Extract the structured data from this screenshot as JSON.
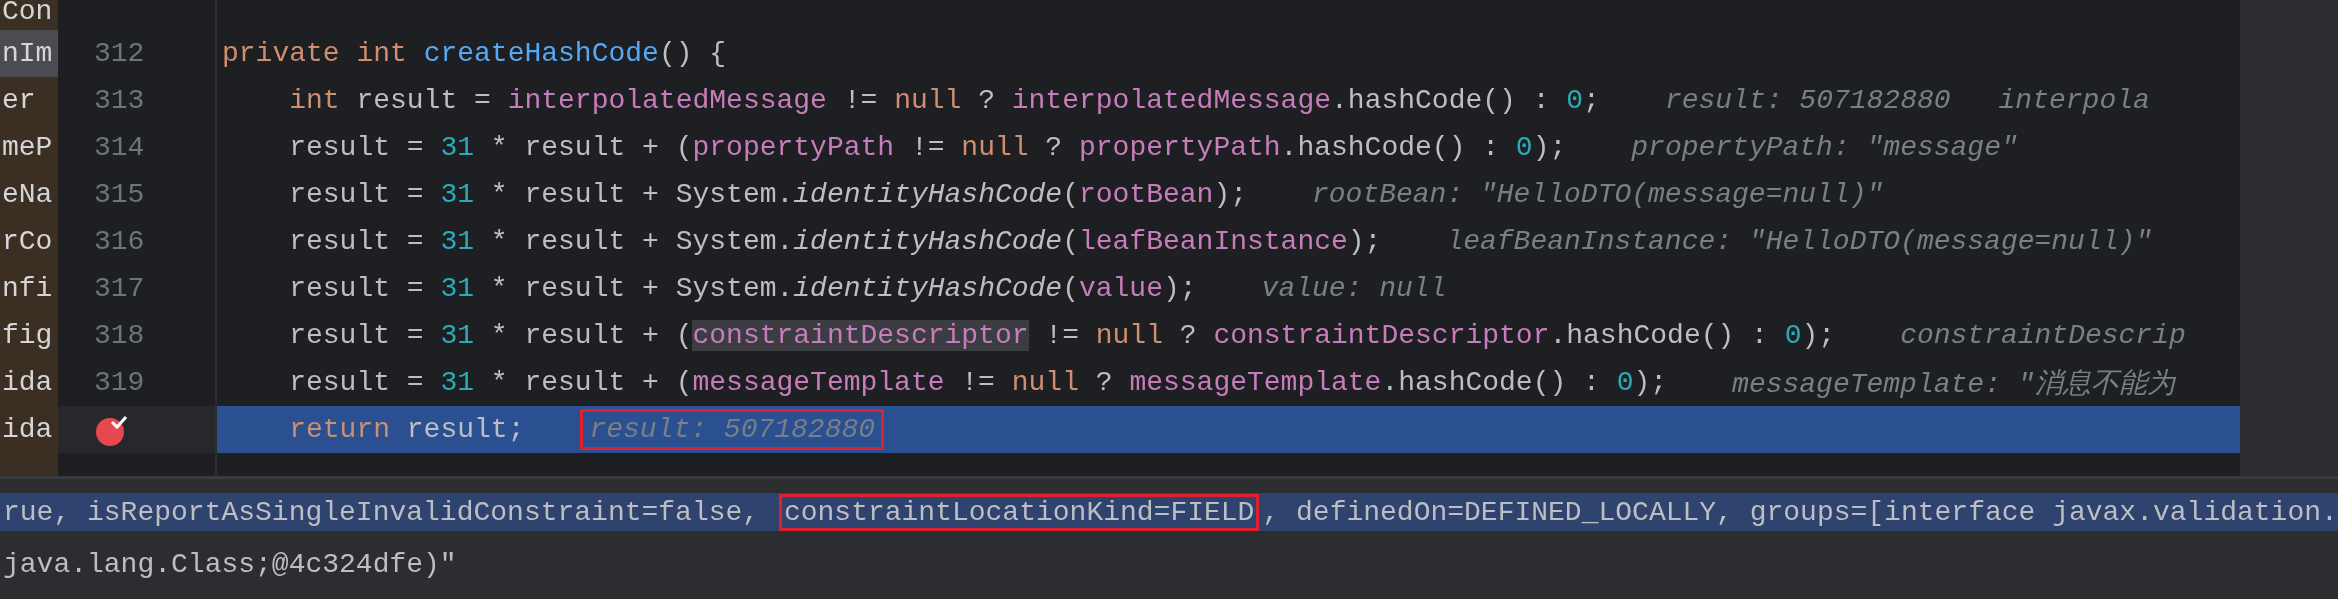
{
  "project_tree": {
    "items": [
      {
        "label": "Con",
        "selected": false
      },
      {
        "label": "nIm",
        "selected": true
      },
      {
        "label": "er",
        "selected": false
      },
      {
        "label": "meP",
        "selected": false
      },
      {
        "label": "eNa",
        "selected": false
      },
      {
        "label": "rCo",
        "selected": false
      },
      {
        "label": "nfi",
        "selected": false
      },
      {
        "label": "fig",
        "selected": false
      },
      {
        "label": "ida",
        "selected": false
      },
      {
        "label": "ida",
        "selected": false
      }
    ]
  },
  "editor": {
    "lines": [
      {
        "number": "312",
        "breakpoint": false,
        "current": false,
        "tokens": [
          {
            "kind": "keyword",
            "text": "private int "
          },
          {
            "kind": "function",
            "text": "createHashCode"
          },
          {
            "kind": "plain",
            "text": "() {"
          }
        ],
        "children": [
          {
            "number": "313",
            "breakpoint": false,
            "current": false,
            "tokens": [
              {
                "kind": "keyword",
                "text": "int "
              },
              {
                "kind": "plain",
                "text": "result = "
              },
              {
                "kind": "field",
                "text": "interpolatedMessage"
              },
              {
                "kind": "plain",
                "text": " != "
              },
              {
                "kind": "keyword",
                "text": "null"
              },
              {
                "kind": "plain",
                "text": " ? "
              },
              {
                "kind": "field",
                "text": "interpolatedMessage"
              },
              {
                "kind": "plain",
                "text": ".hashCode() : "
              },
              {
                "kind": "number",
                "text": "0"
              },
              {
                "kind": "plain",
                "text": ";"
              }
            ],
            "hints": [
              {
                "text": "result: 507182880",
                "outlined": false
              },
              {
                "text": "interpola",
                "outlined": false
              }
            ]
          },
          {
            "number": "314",
            "breakpoint": false,
            "current": false,
            "tokens": [
              {
                "kind": "plain",
                "text": "result = "
              },
              {
                "kind": "number",
                "text": "31"
              },
              {
                "kind": "plain",
                "text": " * result + ("
              },
              {
                "kind": "field",
                "text": "propertyPath"
              },
              {
                "kind": "plain",
                "text": " != "
              },
              {
                "kind": "keyword",
                "text": "null"
              },
              {
                "kind": "plain",
                "text": " ? "
              },
              {
                "kind": "field",
                "text": "propertyPath"
              },
              {
                "kind": "plain",
                "text": ".hashCode() : "
              },
              {
                "kind": "number",
                "text": "0"
              },
              {
                "kind": "plain",
                "text": ");"
              }
            ],
            "hints": [
              {
                "text": "propertyPath: \"message\"",
                "outlined": false
              }
            ]
          },
          {
            "number": "315",
            "breakpoint": false,
            "current": false,
            "tokens": [
              {
                "kind": "plain",
                "text": "result = "
              },
              {
                "kind": "number",
                "text": "31"
              },
              {
                "kind": "plain",
                "text": " * result + System."
              },
              {
                "kind": "call",
                "text": "identityHashCode"
              },
              {
                "kind": "plain",
                "text": "("
              },
              {
                "kind": "field",
                "text": "rootBean"
              },
              {
                "kind": "plain",
                "text": ");"
              }
            ],
            "hints": [
              {
                "text": "rootBean: \"HelloDTO(message=null)\"",
                "outlined": false
              }
            ]
          },
          {
            "number": "316",
            "breakpoint": false,
            "current": false,
            "tokens": [
              {
                "kind": "plain",
                "text": "result = "
              },
              {
                "kind": "number",
                "text": "31"
              },
              {
                "kind": "plain",
                "text": " * result + System."
              },
              {
                "kind": "call",
                "text": "identityHashCode"
              },
              {
                "kind": "plain",
                "text": "("
              },
              {
                "kind": "field",
                "text": "leafBeanInstance"
              },
              {
                "kind": "plain",
                "text": ");"
              }
            ],
            "hints": [
              {
                "text": "leafBeanInstance: \"HelloDTO(message=null)\"",
                "outlined": false
              }
            ]
          },
          {
            "number": "317",
            "breakpoint": false,
            "current": false,
            "tokens": [
              {
                "kind": "plain",
                "text": "result = "
              },
              {
                "kind": "number",
                "text": "31"
              },
              {
                "kind": "plain",
                "text": " * result + System."
              },
              {
                "kind": "call",
                "text": "identityHashCode"
              },
              {
                "kind": "plain",
                "text": "("
              },
              {
                "kind": "field",
                "text": "value"
              },
              {
                "kind": "plain",
                "text": ");"
              }
            ],
            "hints": [
              {
                "text": "value: null",
                "outlined": false
              }
            ]
          },
          {
            "number": "318",
            "breakpoint": false,
            "current": false,
            "tokens": [
              {
                "kind": "plain",
                "text": "result = "
              },
              {
                "kind": "number",
                "text": "31"
              },
              {
                "kind": "plain",
                "text": " * result + ("
              },
              {
                "kind": "field",
                "text": "constraintDescriptor",
                "highlighted": true
              },
              {
                "kind": "plain",
                "text": " != "
              },
              {
                "kind": "keyword",
                "text": "null"
              },
              {
                "kind": "plain",
                "text": " ? "
              },
              {
                "kind": "field",
                "text": "constraintDescriptor"
              },
              {
                "kind": "plain",
                "text": ".hashCode() : "
              },
              {
                "kind": "number",
                "text": "0"
              },
              {
                "kind": "plain",
                "text": ");"
              }
            ],
            "hints": [
              {
                "text": "constraintDescrip",
                "outlined": false
              }
            ]
          },
          {
            "number": "319",
            "breakpoint": false,
            "current": false,
            "tokens": [
              {
                "kind": "plain",
                "text": "result = "
              },
              {
                "kind": "number",
                "text": "31"
              },
              {
                "kind": "plain",
                "text": " * result + ("
              },
              {
                "kind": "field",
                "text": "messageTemplate"
              },
              {
                "kind": "plain",
                "text": " != "
              },
              {
                "kind": "keyword",
                "text": "null"
              },
              {
                "kind": "plain",
                "text": " ? "
              },
              {
                "kind": "field",
                "text": "messageTemplate"
              },
              {
                "kind": "plain",
                "text": ".hashCode() : "
              },
              {
                "kind": "number",
                "text": "0"
              },
              {
                "kind": "plain",
                "text": ");"
              }
            ],
            "hints": [
              {
                "text": "messageTemplate: \"消息不能为",
                "outlined": false
              }
            ]
          },
          {
            "breakpoint": true,
            "current": true,
            "tokens": [
              {
                "kind": "keyword",
                "text": "return "
              },
              {
                "kind": "plain",
                "text": "result;"
              }
            ],
            "hints": [
              {
                "text": "result: 507182880",
                "outlined": true
              }
            ]
          }
        ]
      }
    ]
  },
  "output_panel": {
    "lines": [
      {
        "selected": true,
        "segments": [
          {
            "text": "rue, isReportAsSingleInvalidConstraint=false, ",
            "outlined": false
          },
          {
            "text": "constraintLocationKind=FIELD",
            "outlined": true
          },
          {
            "text": ", definedOn=DEFINED_LOCALLY, groups=[interface javax.validation.",
            "outlined": false
          }
        ]
      },
      {
        "selected": false,
        "segments": [
          {
            "text": "java.lang.Class;@4c324dfe)\"",
            "outlined": false
          }
        ]
      }
    ]
  }
}
